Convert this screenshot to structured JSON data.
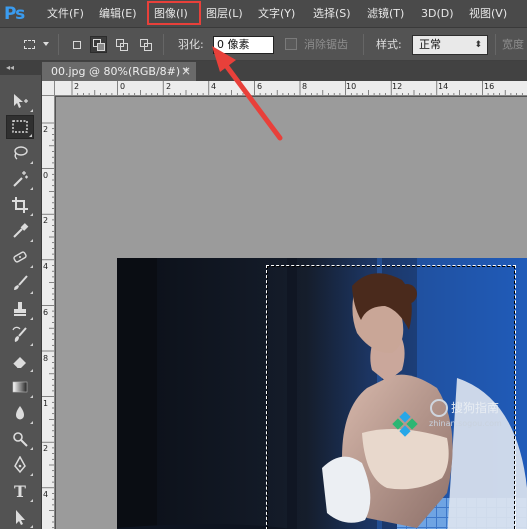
{
  "app": {
    "logo": "Ps",
    "menu": [
      "文件(F)",
      "编辑(E)",
      "图像(I)",
      "图层(L)",
      "文字(Y)",
      "选择(S)",
      "滤镜(T)",
      "3D(D)",
      "视图(V)"
    ],
    "highlighted_menu": "图像(I)"
  },
  "options": {
    "feather_label": "羽化:",
    "feather_value": "0 像素",
    "antialias_label": "消除锯齿",
    "style_label": "样式:",
    "style_value": "正常",
    "width_label": "宽度"
  },
  "document": {
    "tab_title": "00.jpg @ 80%(RGB/8#) *",
    "close_glyph": "×"
  },
  "ruler": {
    "top_labels": [
      "2",
      "0",
      "2",
      "4",
      "6",
      "8",
      "10",
      "12",
      "14",
      "16"
    ],
    "left_labels": [
      "2",
      "0",
      "2",
      "4",
      "6",
      "8",
      "1",
      "2",
      "4"
    ]
  },
  "watermark": {
    "text": "搜狗指南",
    "subtext": "zhinan.sogou.com"
  },
  "colors": {
    "brand_blue": "#3a9cf0",
    "highlight_red": "#e8403a",
    "canvas_gray": "#9b9b9b"
  },
  "toolbox_icons": [
    "move-icon",
    "rectangular-marquee-icon",
    "lasso-icon",
    "magic-wand-icon",
    "crop-icon",
    "eyedropper-icon",
    "healing-brush-icon",
    "brush-icon",
    "clone-stamp-icon",
    "history-brush-icon",
    "eraser-icon",
    "gradient-icon",
    "blur-icon",
    "dodge-icon",
    "pen-icon",
    "type-icon",
    "path-selection-icon"
  ]
}
